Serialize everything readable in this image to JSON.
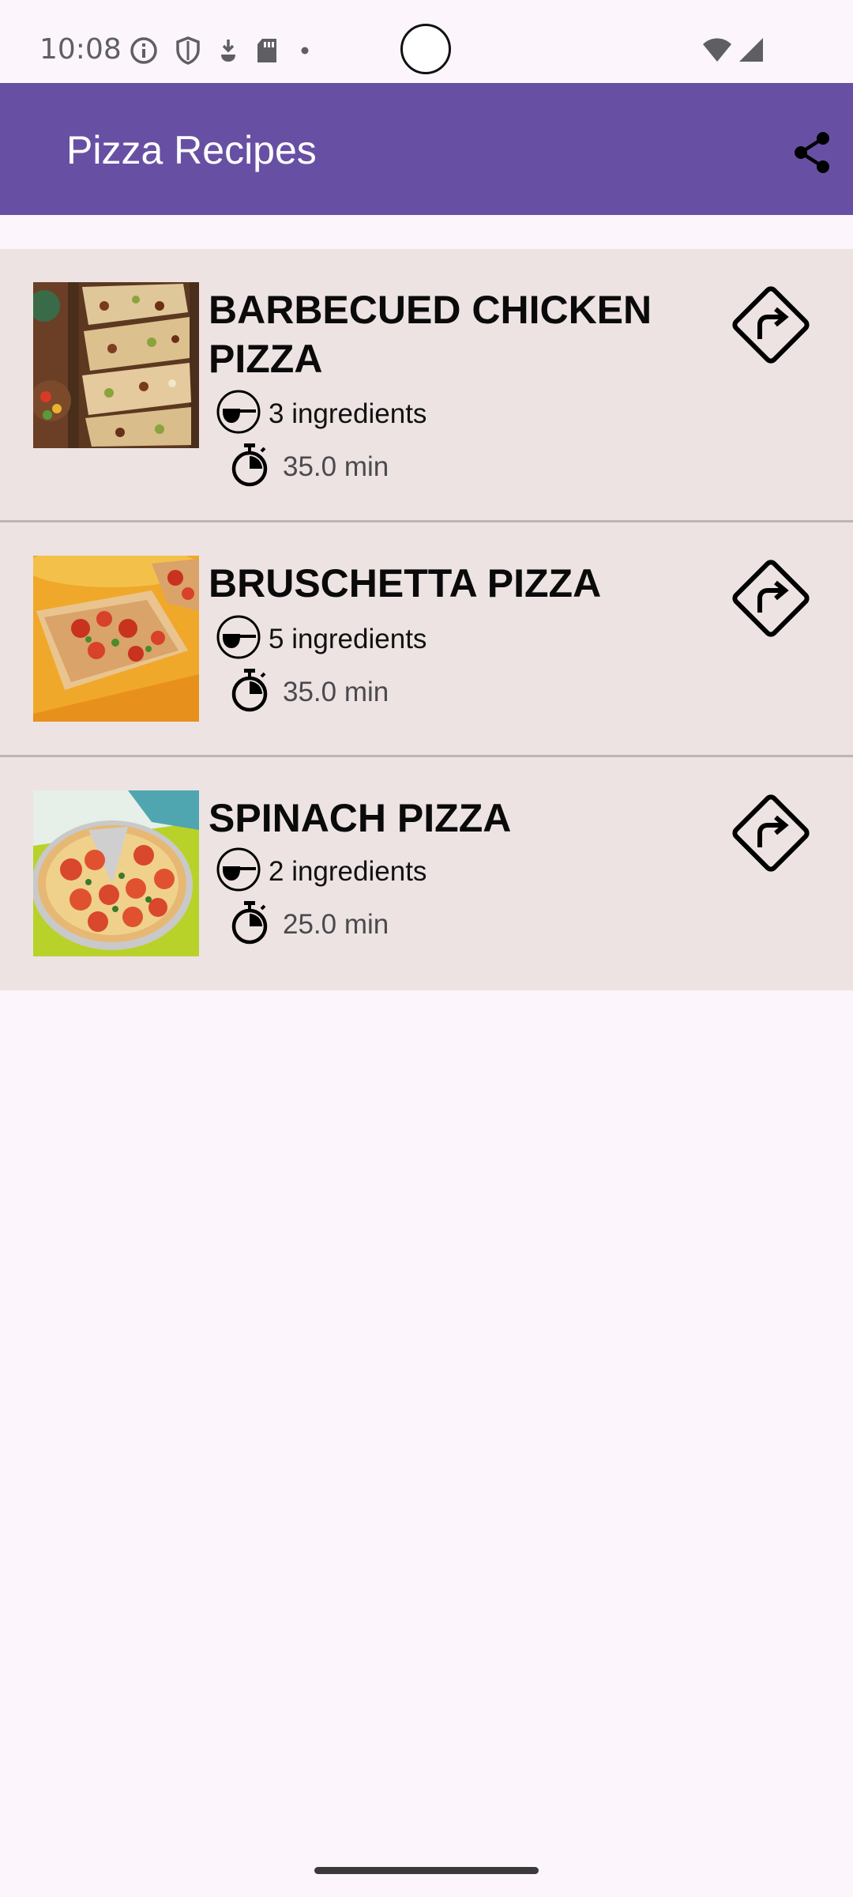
{
  "status_bar": {
    "time": "10:08",
    "icons": [
      "info-icon",
      "shield-icon",
      "download-icon",
      "sd-card-icon",
      "dot-icon",
      "wifi-icon",
      "cell-signal-icon"
    ]
  },
  "app_bar": {
    "title": "Pizza Recipes",
    "action_icon": "share-icon"
  },
  "recipes": [
    {
      "title": "BARBECUED CHICKEN PIZZA",
      "ingredients": "3 ingredients",
      "time": "35.0 min",
      "image": "pizza-thumbnail"
    },
    {
      "title": "BRUSCHETTA PIZZA",
      "ingredients": "5 ingredients",
      "time": "35.0 min",
      "image": "pizza-thumbnail"
    },
    {
      "title": "SPINACH PIZZA",
      "ingredients": "2 ingredients",
      "time": "25.0 min",
      "image": "pizza-thumbnail"
    }
  ],
  "colors": {
    "app_bar": "#6750a4",
    "background": "#fcf6fc",
    "card": "#ede3e3",
    "divider": "#bcb4b6"
  }
}
